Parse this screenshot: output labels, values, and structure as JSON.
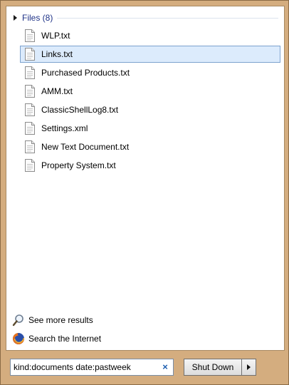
{
  "group": {
    "label": "Files (8)"
  },
  "files": [
    {
      "name": "WLP.txt",
      "selected": false
    },
    {
      "name": "Links.txt",
      "selected": true
    },
    {
      "name": "Purchased Products.txt",
      "selected": false
    },
    {
      "name": "AMM.txt",
      "selected": false
    },
    {
      "name": "ClassicShellLog8.txt",
      "selected": false
    },
    {
      "name": "Settings.xml",
      "selected": false
    },
    {
      "name": "New Text Document.txt",
      "selected": false
    },
    {
      "name": "Property System.txt",
      "selected": false
    }
  ],
  "links": {
    "see_more": "See more results",
    "search_internet": "Search the Internet"
  },
  "search": {
    "value": "kind:documents date:pastweek",
    "clear_glyph": "×"
  },
  "shutdown": {
    "label": "Shut Down"
  },
  "icons": {
    "file": "text-file-icon",
    "see_more": "magnifier-icon",
    "internet": "firefox-icon",
    "clear": "close-icon",
    "arrow": "chevron-right-icon",
    "expand": "triangle-right-icon"
  },
  "colors": {
    "selection": "#dcebfc",
    "selection_border": "#7da2ce",
    "group_text": "#1e3287",
    "frame": "#d4ad7f"
  }
}
